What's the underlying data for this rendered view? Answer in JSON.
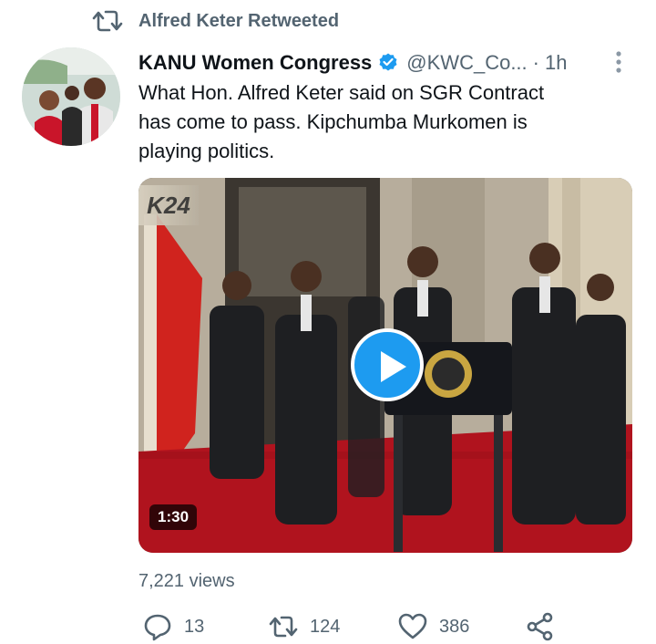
{
  "retweet": {
    "label": "Alfred Keter Retweeted"
  },
  "tweet": {
    "author_name": "KANU Women Congress",
    "handle": "@KWC_Co...",
    "separator": "·",
    "time": "1h",
    "text": "What Hon. Alfred Keter said on SGR Contract\nhas come to pass.  Kipchumba Murkomen is\nplaying politics.",
    "video": {
      "duration": "1:30",
      "channel_logo": "K24"
    },
    "views": "7,221 views",
    "actions": {
      "replies": "13",
      "retweets": "124",
      "likes": "386"
    }
  },
  "icons": {
    "retweet": "retweet-icon",
    "verified": "verified-badge-icon",
    "more": "more-options-icon",
    "play": "play-icon",
    "reply": "reply-icon",
    "like": "heart-icon",
    "share": "share-icon"
  },
  "colors": {
    "accent": "#1d9bf0",
    "secondary_text": "#536471",
    "primary_text": "#0f1419"
  }
}
